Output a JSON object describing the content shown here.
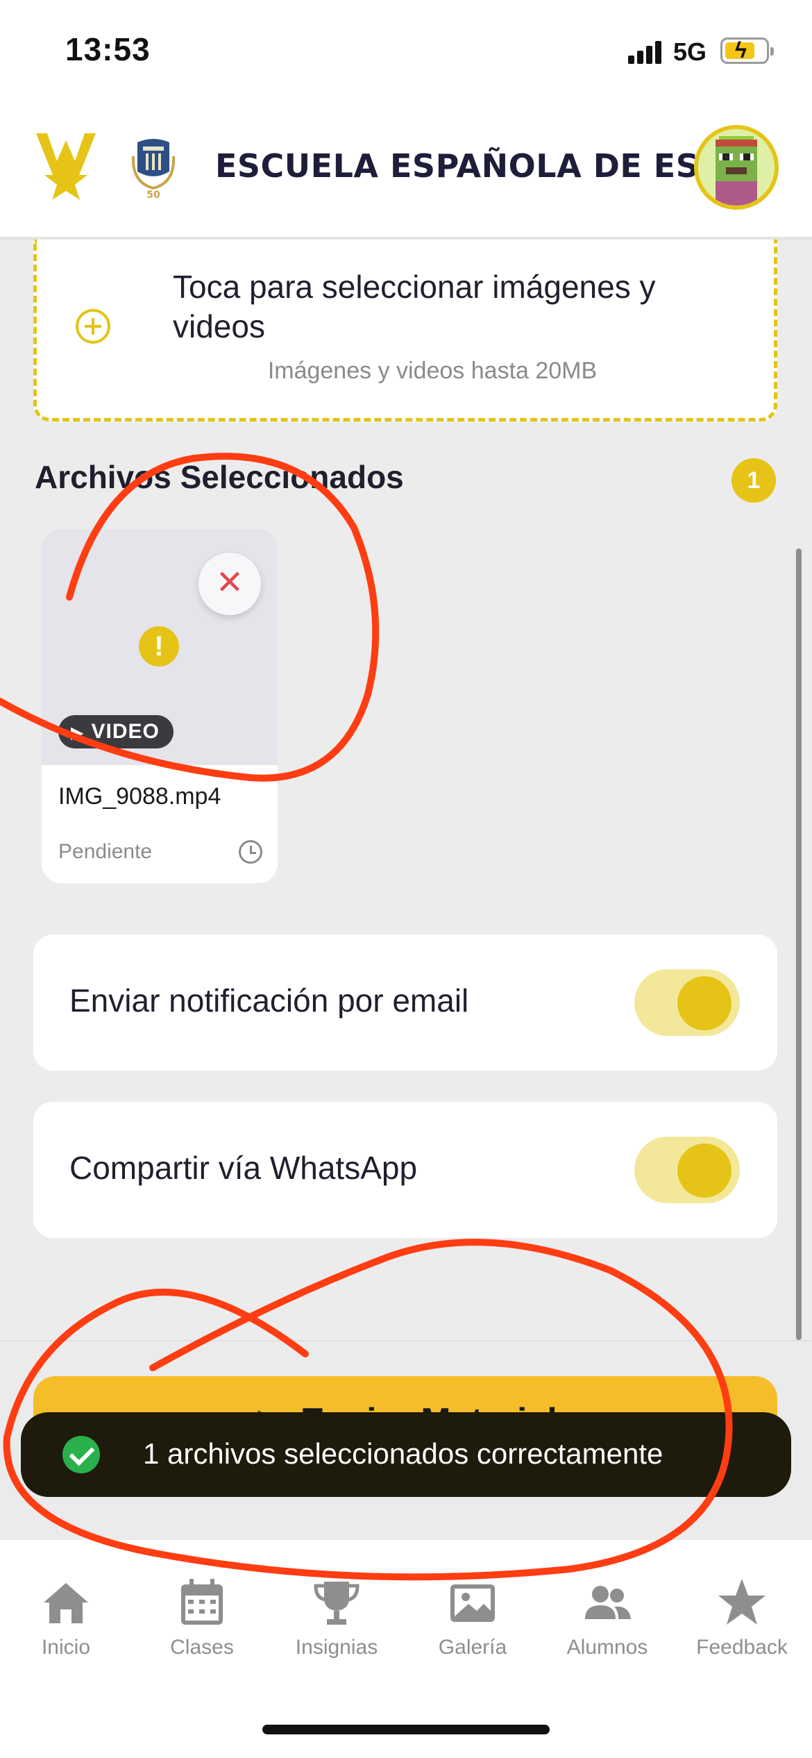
{
  "status_bar": {
    "time": "13:53",
    "network": "5G"
  },
  "header": {
    "title": "ESCUELA ESPAÑOLA DE ESQ..."
  },
  "upload": {
    "title": "Toca para seleccionar imágenes y videos",
    "subtitle": "Imágenes y videos hasta 20MB"
  },
  "selected_files": {
    "title": "Archivos Seleccionados",
    "count": "1",
    "items": [
      {
        "type_label": "VIDEO",
        "name": "IMG_9088.mp4",
        "status": "Pendiente"
      }
    ]
  },
  "options": {
    "email": {
      "label": "Enviar notificación por email",
      "enabled": true
    },
    "whatsapp": {
      "label": "Compartir vía WhatsApp",
      "enabled": true
    }
  },
  "send_button": {
    "label": "Enviar Material"
  },
  "toast": {
    "message": "1 archivos seleccionados correctamente"
  },
  "tab_bar": {
    "items": [
      {
        "label": "Inicio",
        "icon": "home-icon"
      },
      {
        "label": "Clases",
        "icon": "calendar-icon"
      },
      {
        "label": "Insignias",
        "icon": "trophy-icon"
      },
      {
        "label": "Galería",
        "icon": "image-icon"
      },
      {
        "label": "Alumnos",
        "icon": "people-icon"
      },
      {
        "label": "Feedback",
        "icon": "star-icon"
      }
    ]
  },
  "colors": {
    "accent": "#e6c417",
    "send_button": "#f6bd2a",
    "toast_bg": "#1e1a0c",
    "annotation": "#ff3d12"
  }
}
